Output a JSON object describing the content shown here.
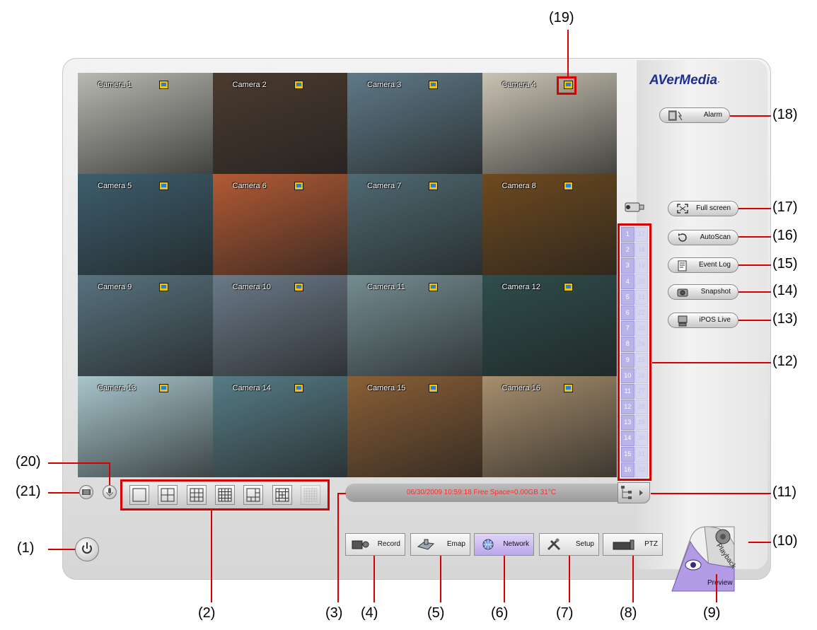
{
  "app": {
    "brand": "AVerMedia",
    "brand_mark": "·"
  },
  "cameras": [
    {
      "label": "Camera 1",
      "bg": "#b9b9b2"
    },
    {
      "label": "Camera 2",
      "bg": "#4b3b2f"
    },
    {
      "label": "Camera 3",
      "bg": "#5f7a88"
    },
    {
      "label": "Camera 4",
      "bg": "#c9c4b4"
    },
    {
      "label": "Camera 5",
      "bg": "#3d5e6d"
    },
    {
      "label": "Camera 6",
      "bg": "#b25a34"
    },
    {
      "label": "Camera 7",
      "bg": "#4f6a72"
    },
    {
      "label": "Camera 8",
      "bg": "#6e4a1f"
    },
    {
      "label": "Camera 9",
      "bg": "#58737f"
    },
    {
      "label": "Camera 10",
      "bg": "#6b7a88"
    },
    {
      "label": "Camera 11",
      "bg": "#748d92"
    },
    {
      "label": "Camera 12",
      "bg": "#2e4e4c"
    },
    {
      "label": "Camera 13",
      "bg": "#a8c6cc"
    },
    {
      "label": "Camera 14",
      "bg": "#567c86"
    },
    {
      "label": "Camera 15",
      "bg": "#8a5f36"
    },
    {
      "label": "Camera 16",
      "bg": "#a78f6e"
    }
  ],
  "channels_left": [
    "1",
    "2",
    "3",
    "4",
    "5",
    "6",
    "7",
    "8",
    "9",
    "10",
    "11",
    "12",
    "13",
    "14",
    "15",
    "16"
  ],
  "channels_right": [
    "17",
    "18",
    "19",
    "20",
    "21",
    "22",
    "23",
    "24",
    "25",
    "26",
    "27",
    "28",
    "29",
    "30",
    "31",
    "32"
  ],
  "side_buttons": {
    "alarm": "Alarm",
    "full_screen": "Full screen",
    "autoscan": "AutoScan",
    "event_log": "Event Log",
    "snapshot": "Snapshot",
    "ipos_live": "iPOS Live"
  },
  "bottom_buttons": {
    "record": "Record",
    "emap": "Emap",
    "network": "Network",
    "setup": "Setup",
    "ptz": "PTZ"
  },
  "mode": {
    "playback": "Playback",
    "preview": "Preview"
  },
  "status_text": "06/30/2009 10:59:18  Free Space=0.00GB 31°C",
  "callouts": {
    "c1": "(1)",
    "c2": "(2)",
    "c3": "(3)",
    "c4": "(4)",
    "c5": "(5)",
    "c6": "(6)",
    "c7": "(7)",
    "c8": "(8)",
    "c9": "(9)",
    "c10": "(10)",
    "c11": "(11)",
    "c12": "(12)",
    "c13": "(13)",
    "c14": "(14)",
    "c15": "(15)",
    "c16": "(16)",
    "c17": "(17)",
    "c18": "(18)",
    "c19": "(19)",
    "c20": "(20)",
    "c21": "(21)"
  },
  "colors": {
    "callout_line": "#d60000",
    "status_text": "#ff2b2b",
    "brand_blue": "#1d2f8c",
    "channel_active": "#b9b4e8",
    "network_highlight": "#c9b8f0"
  },
  "icons": {
    "record": "camera-record-icon",
    "emap": "map-icon",
    "network": "globe-icon",
    "setup": "tools-icon",
    "ptz": "ptz-camera-icon",
    "alarm": "alarm-icon",
    "full_screen": "fullscreen-icon",
    "autoscan": "autoscan-icon",
    "event_log": "event-log-icon",
    "snapshot": "snapshot-icon",
    "ipos_live": "ipos-icon",
    "power": "power-icon",
    "keyboard": "keyboard-icon",
    "microphone": "microphone-icon"
  }
}
